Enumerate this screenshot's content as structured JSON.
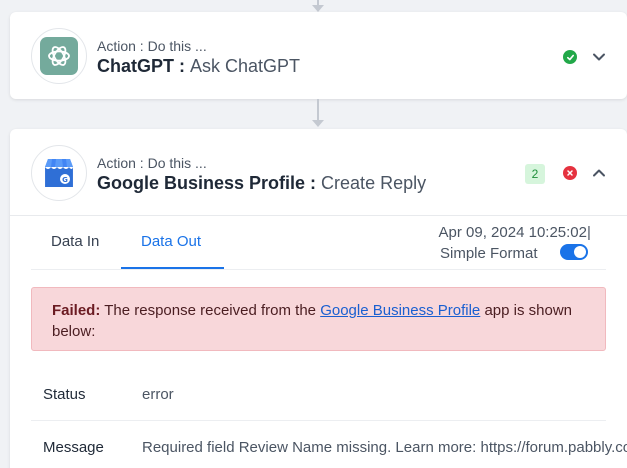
{
  "step1": {
    "action_label": "Action : Do this ...",
    "app_name": "ChatGPT",
    "separator": " : ",
    "event_name": "Ask ChatGPT",
    "status": "success",
    "icon": "chatgpt-logo-icon"
  },
  "step2": {
    "action_label": "Action : Do this ...",
    "app_name": "Google Business Profile",
    "separator": " : ",
    "event_name": "Create Reply",
    "badge_count": "2",
    "status": "error",
    "icon": "google-business-profile-icon"
  },
  "tabs": {
    "data_in": "Data In",
    "data_out": "Data Out",
    "active": "data_out"
  },
  "meta": {
    "timestamp": "Apr 09, 2024 10:25:02",
    "pipe": "|",
    "simple_format_label": "Simple Format",
    "simple_format_on": true
  },
  "alert": {
    "prefix": "Failed:",
    "text_before": " The response received from the ",
    "link_text": "Google Business Profile",
    "text_after": " app is shown below:"
  },
  "rows": [
    {
      "label": "Status",
      "value": "error"
    },
    {
      "label": "Message",
      "value": "Required field Review Name missing. Learn more: https://forum.pabbly.com"
    }
  ],
  "colors": {
    "accent": "#1a73e8",
    "success": "#22a849",
    "error": "#e5323f",
    "alert_bg": "#f8d7da",
    "chatgpt_green": "#74aa9c"
  }
}
